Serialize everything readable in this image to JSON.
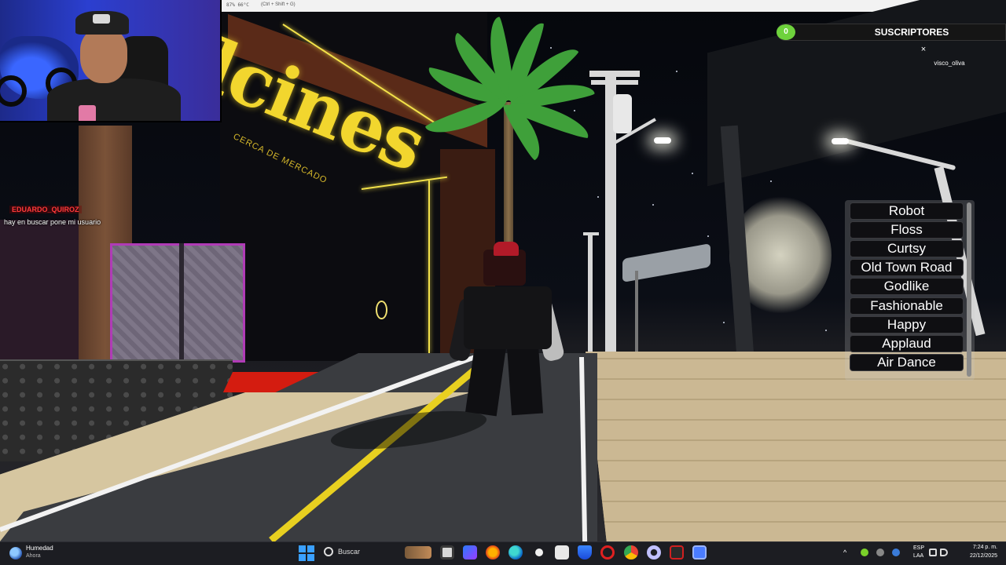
{
  "window": {
    "fps_text": "87% 66°C",
    "shortcut_hint": "(Ctrl + Shift + G)",
    "minimize": "—",
    "maximize": "❐",
    "close": "✕"
  },
  "building_sign": {
    "main": "lcines",
    "sub": "CERCA DE MERCADO"
  },
  "chat": {
    "username": "EDUARDO_QUIROZ",
    "message": "hay en buscar pone mi usuario"
  },
  "subscribers": {
    "count": "0",
    "title": "SUSCRIPTORES",
    "close_icon": "×",
    "user": "visco_oliva"
  },
  "emotes": [
    "Robot",
    "Floss",
    "Curtsy",
    "Old Town Road",
    "Godlike",
    "Fashionable",
    "Happy",
    "Applaud",
    "Air Dance"
  ],
  "taskbar": {
    "weather_title": "Humedad",
    "weather_sub": "Ahora",
    "search_label": "Buscar",
    "lang_1": "ESP",
    "lang_2": "LAA",
    "time": "7:24 p. m.",
    "date": "22/12/2025"
  },
  "colors": {
    "sign_yellow": "#f2d62e",
    "subs_green": "#6ed23c",
    "emote_bg": "#0f0f12",
    "taskbar_bg": "#1c1d22"
  }
}
